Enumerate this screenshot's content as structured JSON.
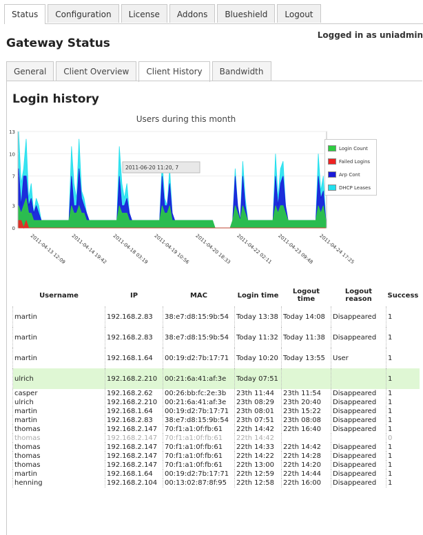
{
  "tabs": [
    "Status",
    "Configuration",
    "License",
    "Addons",
    "Blueshield",
    "Logout"
  ],
  "login_info": "Logged in as uniadmin",
  "page_title": "Gateway Status",
  "subtabs": [
    "General",
    "Client Overview",
    "Client History",
    "Bandwidth"
  ],
  "section_title": "Login history",
  "chart_data": {
    "type": "area",
    "title": "Users during this month",
    "yticks": [
      0,
      3,
      7,
      10,
      13
    ],
    "ylim": [
      0,
      13
    ],
    "xticks": [
      "2011-04-13 12:09",
      "2011-04-14 19:42",
      "2011-04-18 03:19",
      "2011-04-19 10:56",
      "2011-04-20 18:33",
      "2011-04-22 02:11",
      "2011-04-23 09:48",
      "2011-04-24 17:25"
    ],
    "tooltip": "2011-06-20 11:20, 7",
    "legend": [
      "Login Count",
      "Failed Logins",
      "Arp Cont",
      "DHCP Leases"
    ],
    "colors": {
      "login": "#2ecc40",
      "failed": "#ee2222",
      "arp": "#1a1ad8",
      "dhcp": "#22e0ee"
    },
    "series": [
      {
        "name": "DHCP Leases",
        "values": [
          13,
          6,
          8,
          12,
          4,
          6,
          2,
          4,
          3,
          1,
          1,
          1,
          1,
          1,
          1,
          1,
          1,
          1,
          1,
          1,
          1,
          11,
          6,
          4,
          12,
          5,
          4,
          2,
          1,
          1,
          1,
          1,
          1,
          1,
          1,
          1,
          1,
          1,
          1,
          1,
          11,
          6,
          4,
          6,
          2,
          1,
          1,
          1,
          1,
          1,
          1,
          1,
          1,
          1,
          1,
          1,
          1,
          9,
          4,
          3,
          8,
          2,
          1,
          1,
          1,
          1,
          1,
          1,
          1,
          1,
          1,
          1,
          1,
          1,
          1,
          1,
          1,
          1,
          0,
          0,
          0,
          0,
          0,
          0,
          0,
          1,
          8,
          3,
          1,
          9,
          4,
          1,
          1,
          1,
          1,
          1,
          1,
          1,
          1,
          1,
          1,
          1,
          10,
          4,
          8,
          9,
          3,
          1,
          1,
          1,
          1,
          1,
          1,
          1,
          1,
          1,
          1,
          1,
          1,
          10,
          5,
          7,
          1
        ]
      },
      {
        "name": "Arp Cont",
        "values": [
          8,
          3,
          7,
          7,
          3,
          4,
          2,
          3,
          2,
          1,
          1,
          1,
          1,
          1,
          1,
          1,
          1,
          1,
          1,
          1,
          1,
          7,
          3,
          3,
          8,
          4,
          3,
          2,
          1,
          1,
          1,
          1,
          1,
          1,
          1,
          1,
          1,
          1,
          1,
          1,
          7,
          3,
          3,
          4,
          2,
          1,
          1,
          1,
          1,
          1,
          1,
          1,
          1,
          1,
          1,
          1,
          1,
          7,
          3,
          3,
          6,
          2,
          1,
          1,
          1,
          1,
          1,
          1,
          1,
          1,
          1,
          1,
          1,
          1,
          1,
          1,
          1,
          1,
          0,
          0,
          0,
          0,
          0,
          0,
          0,
          1,
          7,
          3,
          1,
          7,
          3,
          1,
          1,
          1,
          1,
          1,
          1,
          1,
          1,
          1,
          1,
          1,
          7,
          3,
          6,
          7,
          3,
          1,
          1,
          1,
          1,
          1,
          1,
          1,
          1,
          1,
          1,
          1,
          1,
          7,
          4,
          5,
          1
        ]
      },
      {
        "name": "Login Count",
        "values": [
          3,
          2,
          3,
          4,
          2,
          2,
          1,
          1,
          1,
          1,
          1,
          1,
          1,
          1,
          1,
          1,
          1,
          1,
          1,
          1,
          1,
          3,
          2,
          2,
          3,
          2,
          2,
          1,
          1,
          1,
          1,
          1,
          1,
          1,
          1,
          1,
          1,
          1,
          1,
          1,
          3,
          2,
          2,
          2,
          1,
          1,
          1,
          1,
          1,
          1,
          1,
          1,
          1,
          1,
          1,
          1,
          1,
          3,
          2,
          2,
          3,
          1,
          1,
          1,
          1,
          1,
          1,
          1,
          1,
          1,
          1,
          1,
          1,
          1,
          1,
          1,
          1,
          1,
          0,
          0,
          0,
          0,
          0,
          0,
          0,
          1,
          3,
          2,
          1,
          3,
          2,
          1,
          1,
          1,
          1,
          1,
          1,
          1,
          1,
          1,
          1,
          1,
          3,
          2,
          3,
          3,
          2,
          1,
          1,
          1,
          1,
          1,
          1,
          1,
          1,
          1,
          1,
          1,
          1,
          3,
          2,
          3,
          1
        ]
      },
      {
        "name": "Failed Logins",
        "values": [
          1,
          1,
          0,
          1,
          0,
          0,
          0,
          0,
          0,
          0,
          0,
          0,
          0,
          0,
          0,
          0,
          0,
          0,
          0,
          0,
          0,
          0,
          0,
          0,
          0,
          0,
          0,
          0,
          0,
          0,
          0,
          0,
          0,
          0,
          0,
          0,
          0,
          0,
          0,
          0,
          0,
          0,
          0,
          0,
          0,
          0,
          0,
          0,
          0,
          0,
          0,
          0,
          0,
          0,
          0,
          0,
          0,
          0,
          0,
          0,
          0,
          0,
          0,
          0,
          0,
          0,
          0,
          0,
          0,
          0,
          0,
          0,
          0,
          0,
          0,
          0,
          0,
          0,
          0,
          0,
          0,
          0,
          0,
          0,
          0,
          0,
          0,
          0,
          0,
          0,
          0,
          0,
          0,
          0,
          0,
          0,
          0,
          0,
          0,
          0,
          0,
          0,
          0,
          0,
          0,
          0,
          0,
          0,
          0,
          0,
          0,
          0,
          0,
          0,
          0,
          0,
          0,
          0,
          0,
          0,
          0,
          0,
          0
        ]
      }
    ]
  },
  "table": {
    "headers": [
      "Username",
      "IP",
      "MAC",
      "Login time",
      "Logout time",
      "Logout reason",
      "Success"
    ],
    "rows": [
      {
        "cells": [
          "martin",
          "192.168.2.83",
          "38:e7:d8:15:9b:54",
          "Today 13:38",
          "Today 14:08",
          "Disappeared",
          "1"
        ],
        "style": "tall"
      },
      {
        "cells": [
          "martin",
          "192.168.2.83",
          "38:e7:d8:15:9b:54",
          "Today 11:32",
          "Today 11:38",
          "Disappeared",
          "1"
        ],
        "style": "tall"
      },
      {
        "cells": [
          "martin",
          "192.168.1.64",
          "00:19:d2:7b:17:71",
          "Today 10:20",
          "Today 13:55",
          "User",
          "1"
        ],
        "style": "tall"
      },
      {
        "cells": [
          "ulrich",
          "192.168.2.210",
          "00:21:6a:41:af:3e",
          "Today 07:51",
          "",
          "",
          "1"
        ],
        "style": "tall active"
      },
      {
        "cells": [
          "casper",
          "192.168.2.62",
          "00:26:bb:fc:2e:3b",
          "23th 11:44",
          "23th 11:54",
          "Disappeared",
          "1"
        ],
        "style": ""
      },
      {
        "cells": [
          "ulrich",
          "192.168.2.210",
          "00:21:6a:41:af:3e",
          "23th 08:29",
          "23th 20:40",
          "Disappeared",
          "1"
        ],
        "style": ""
      },
      {
        "cells": [
          "martin",
          "192.168.1.64",
          "00:19:d2:7b:17:71",
          "23th 08:01",
          "23th 15:22",
          "Disappeared",
          "1"
        ],
        "style": ""
      },
      {
        "cells": [
          "martin",
          "192.168.2.83",
          "38:e7:d8:15:9b:54",
          "23th 07:51",
          "23th 08:08",
          "Disappeared",
          "1"
        ],
        "style": ""
      },
      {
        "cells": [
          "thomas",
          "192.168.2.147",
          "70:f1:a1:0f:fb:61",
          "22th 14:42",
          "22th 16:40",
          "Disappeared",
          "1"
        ],
        "style": ""
      },
      {
        "cells": [
          "thomas",
          "192.168.2.147",
          "70:f1:a1:0f:fb:61",
          "22th 14:42",
          "",
          "",
          "0"
        ],
        "style": "failed"
      },
      {
        "cells": [
          "thomas",
          "192.168.2.147",
          "70:f1:a1:0f:fb:61",
          "22th 14:33",
          "22th 14:42",
          "Disappeared",
          "1"
        ],
        "style": ""
      },
      {
        "cells": [
          "thomas",
          "192.168.2.147",
          "70:f1:a1:0f:fb:61",
          "22th 14:22",
          "22th 14:28",
          "Disappeared",
          "1"
        ],
        "style": ""
      },
      {
        "cells": [
          "thomas",
          "192.168.2.147",
          "70:f1:a1:0f:fb:61",
          "22th 13:00",
          "22th 14:20",
          "Disappeared",
          "1"
        ],
        "style": ""
      },
      {
        "cells": [
          "martin",
          "192.168.1.64",
          "00:19:d2:7b:17:71",
          "22th 12:59",
          "22th 14:44",
          "Disappeared",
          "1"
        ],
        "style": ""
      },
      {
        "cells": [
          "henning",
          "192.168.2.104",
          "00:13:02:87:8f:95",
          "22th 12:58",
          "22th 16:00",
          "Disappeared",
          "1"
        ],
        "style": ""
      }
    ]
  }
}
